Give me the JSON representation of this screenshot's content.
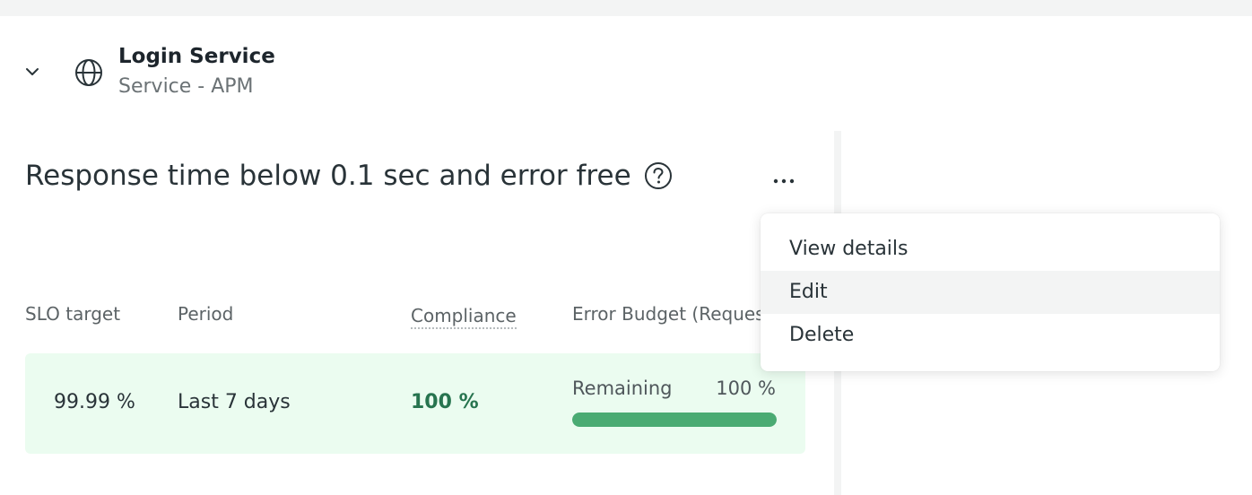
{
  "entity": {
    "name": "Login Service",
    "type": "Service - APM",
    "icon": "globe-icon"
  },
  "slo": {
    "title": "Response time below 0.1 sec and error free",
    "help_icon": "question-circle-icon",
    "more_icon": "ellipsis-icon"
  },
  "table": {
    "headers": {
      "target": "SLO target",
      "period": "Period",
      "compliance": "Compliance",
      "budget": "Error Budget (Requests)"
    },
    "row": {
      "target": "99.99 %",
      "period": "Last 7 days",
      "compliance": "100 %",
      "budget_label": "Remaining",
      "budget_value": "100 %",
      "budget_fraction": 1.0
    }
  },
  "menu": {
    "items": [
      {
        "label": "View details"
      },
      {
        "label": "Edit"
      },
      {
        "label": "Delete"
      }
    ],
    "hovered_index": 1
  },
  "colors": {
    "row_background": "#ebfcf0",
    "compliance_text": "#27744f",
    "bar_fill": "#4aab73"
  }
}
